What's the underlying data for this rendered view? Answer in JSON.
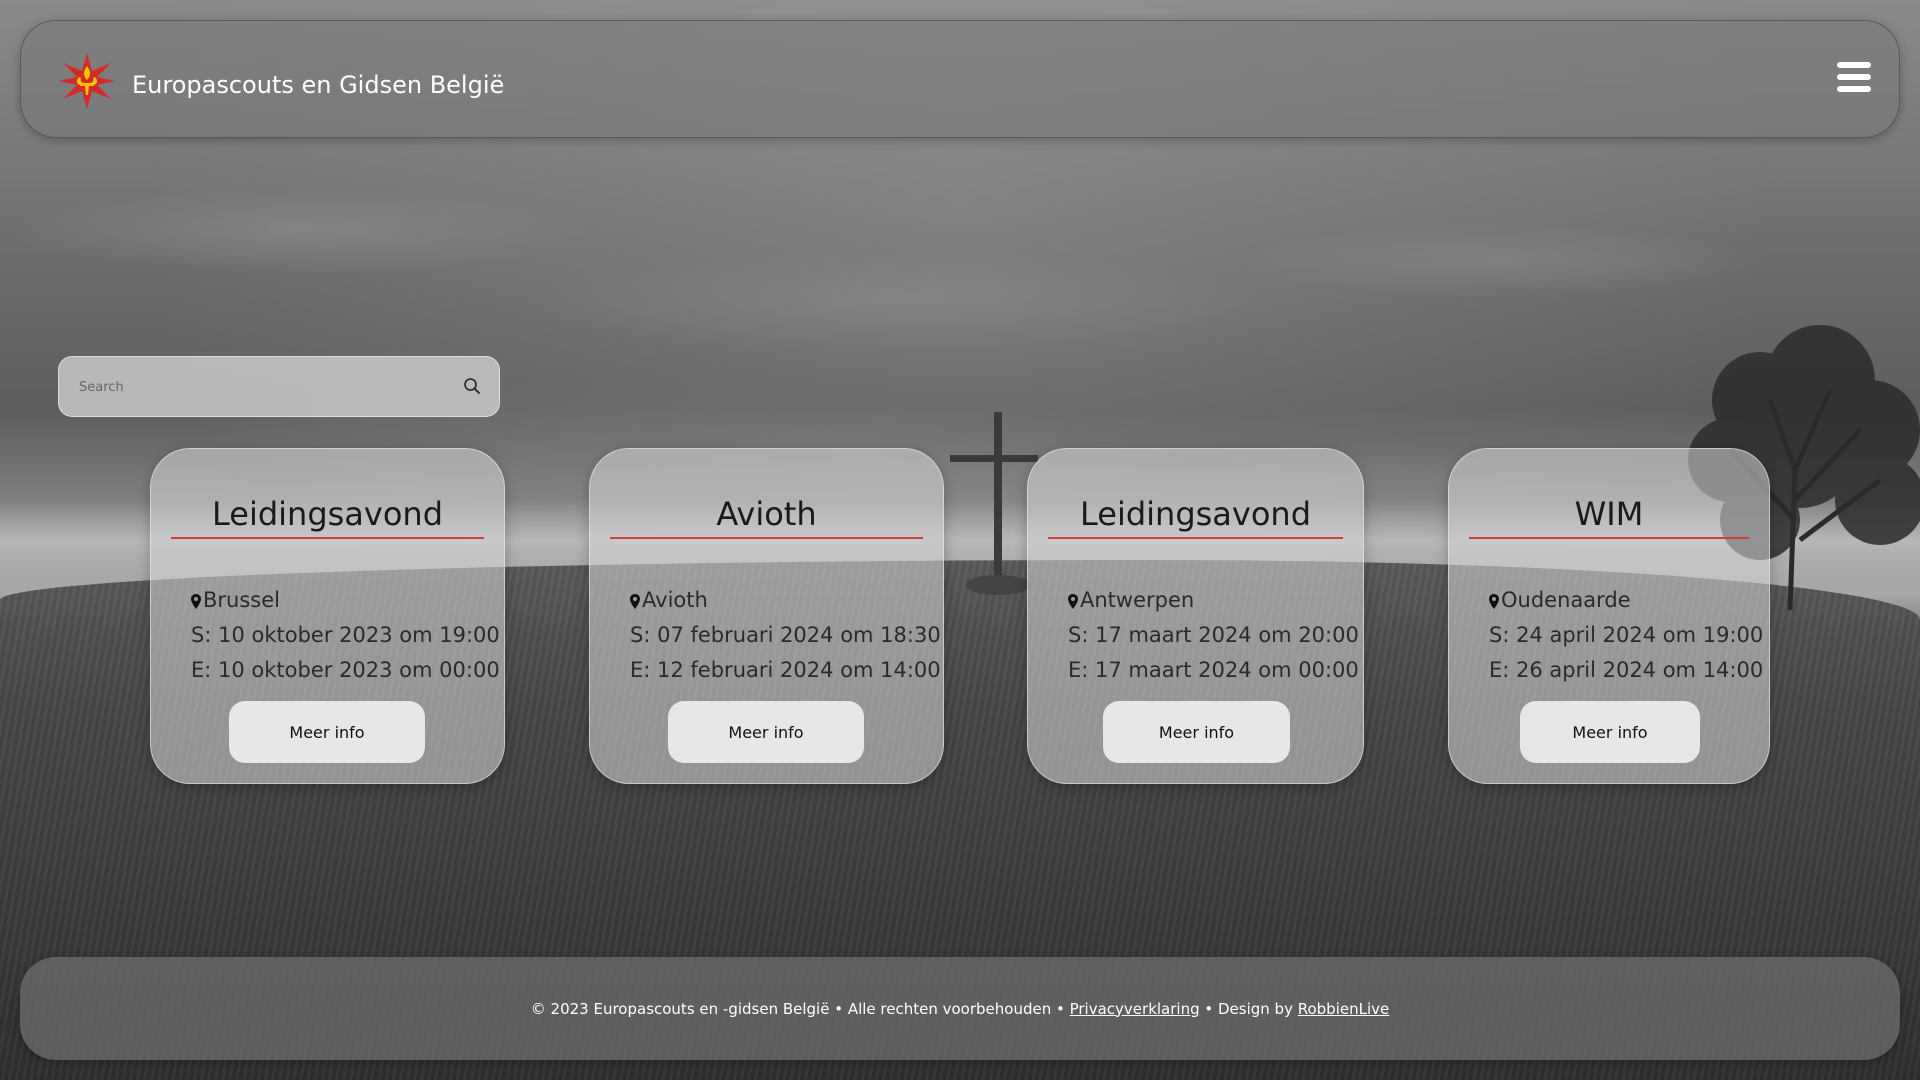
{
  "header": {
    "title": "Europascouts en Gidsen België",
    "logo_icon": "fleur-de-lis-star-icon",
    "menu_icon": "hamburger-menu-icon"
  },
  "search": {
    "placeholder": "Search",
    "value": "",
    "icon": "search-icon"
  },
  "events": [
    {
      "title": "Leidingsavond",
      "location": "Brussel",
      "start": "S: 10 oktober 2023 om 19:00",
      "end": "E: 10 oktober 2023 om 00:00",
      "button": "Meer info"
    },
    {
      "title": "Avioth",
      "location": "Avioth",
      "start": "S: 07 februari 2024 om 18:30",
      "end": "E: 12 februari 2024 om 14:00",
      "button": "Meer info"
    },
    {
      "title": "Leidingsavond",
      "location": "Antwerpen",
      "start": "S: 17 maart 2024 om 20:00",
      "end": "E: 17 maart 2024 om 00:00",
      "button": "Meer info"
    },
    {
      "title": "WIM",
      "location": "Oudenaarde",
      "start": "S: 24 april 2024 om 19:00",
      "end": "E: 26 april 2024 om 14:00",
      "button": "Meer info"
    }
  ],
  "footer": {
    "copyright": "© 2023 Europascouts en -gidsen België • Alle rechten voorbehouden • ",
    "privacy_link": "Privacyverklaring",
    "design_by": " • Design by ",
    "designer_link": "RobbienLive"
  },
  "colors": {
    "accent_rule": "#d04040",
    "logo_red": "#d42a2a",
    "logo_gold": "#f2c200"
  }
}
